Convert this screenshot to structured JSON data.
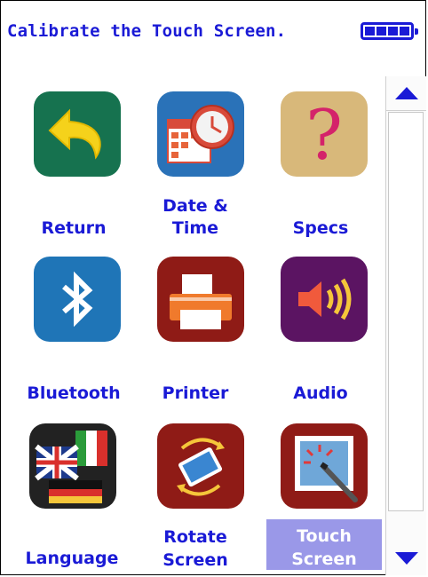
{
  "header": {
    "title": "Calibrate the Touch Screen."
  },
  "battery": {
    "cells": 4,
    "color": "#1a1ad6"
  },
  "menu": {
    "items": [
      {
        "label": "Return",
        "icon": "return-arrow-icon"
      },
      {
        "label": "Date &",
        "label2": "Time",
        "icon": "calendar-clock-icon"
      },
      {
        "label": "Specs",
        "icon": "question-mark-icon"
      },
      {
        "label": "Bluetooth",
        "icon": "bluetooth-icon"
      },
      {
        "label": "Printer",
        "icon": "printer-icon"
      },
      {
        "label": "Audio",
        "icon": "speaker-icon"
      },
      {
        "label": "Language",
        "icon": "language-flags-icon"
      },
      {
        "label": "Rotate",
        "label2": "Screen",
        "icon": "rotate-screen-icon"
      },
      {
        "label": "Touch",
        "label2": "Screen",
        "icon": "touch-screen-icon",
        "selected": true
      }
    ]
  },
  "scrollbar": {
    "up": "scroll-up-arrow",
    "down": "scroll-down-arrow"
  }
}
